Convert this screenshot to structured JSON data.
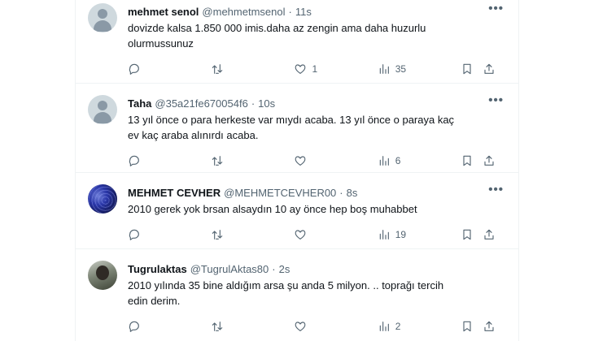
{
  "tweets": [
    {
      "name": "mehmet senol",
      "handle": "@mehmetmsenol",
      "time": "11s",
      "avatar": "default",
      "text": "dovizde kalsa 1.850 000 imis.daha az zengin ama daha huzurlu olurmussunuz",
      "replies": "",
      "retweets": "",
      "likes": "1",
      "views": "35"
    },
    {
      "name": "Taha",
      "handle": "@35a21fe670054f6",
      "time": "10s",
      "avatar": "default",
      "text": "13 yıl önce o para herkeste var mıydı acaba. 13 yıl önce o paraya kaç ev kaç araba alınırdı acaba.",
      "replies": "",
      "retweets": "",
      "likes": "",
      "views": "6"
    },
    {
      "name": "MEHMET CEVHER",
      "handle": "@MEHMETCEVHER00",
      "time": "8s",
      "avatar": "blue",
      "text": "2010 gerek yok brsan alsaydın 10 ay önce hep boş muhabbet",
      "replies": "",
      "retweets": "",
      "likes": "",
      "views": "19"
    },
    {
      "name": "Tugrulaktas",
      "handle": "@TugrulAktas80",
      "time": "2s",
      "avatar": "photo",
      "text": "2010 yılında 35 bine aldığım arsa şu anda 5 milyon. ..  toprağı tercih edin derim.",
      "replies": "",
      "retweets": "",
      "likes": "",
      "views": "2"
    }
  ],
  "separator": "·",
  "more_glyph": "•••",
  "icons": [
    "reply-icon",
    "retweet-icon",
    "like-icon",
    "views-icon",
    "bookmark-icon",
    "share-icon"
  ]
}
